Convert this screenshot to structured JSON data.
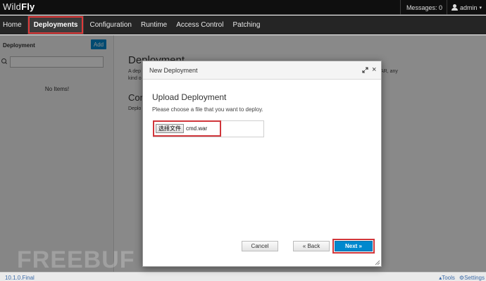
{
  "app": {
    "logo_light": "Wild",
    "logo_bold": "Fly"
  },
  "topbar": {
    "messages": "Messages: 0",
    "user": "admin"
  },
  "nav": {
    "home": "Home",
    "deployments": "Deployments",
    "configuration": "Configuration",
    "runtime": "Runtime",
    "access_control": "Access Control",
    "patching": "Patching"
  },
  "sidebar": {
    "title": "Deployment",
    "add_label": "Add",
    "search_value": "",
    "empty": "No Items!"
  },
  "background": {
    "heading": "Deployment",
    "para_start": "A dep",
    "para_cont": "kind o",
    "para_end": "AR, any",
    "heading2": "Con",
    "para2": "Deplo"
  },
  "modal": {
    "title": "New Deployment",
    "heading": "Upload Deployment",
    "description": "Please choose a file that you want to deploy.",
    "choose_file": "选择文件",
    "file_name": "cmd.war",
    "cancel": "Cancel",
    "back": "« Back",
    "next": "Next »"
  },
  "footer": {
    "version": "10.1.0.Final",
    "tools": "Tools",
    "settings": "Settings"
  },
  "watermark": "FREEBUF",
  "colors": {
    "accent": "#0088ce",
    "highlight": "#d0363b",
    "nav_bg": "#252525"
  }
}
